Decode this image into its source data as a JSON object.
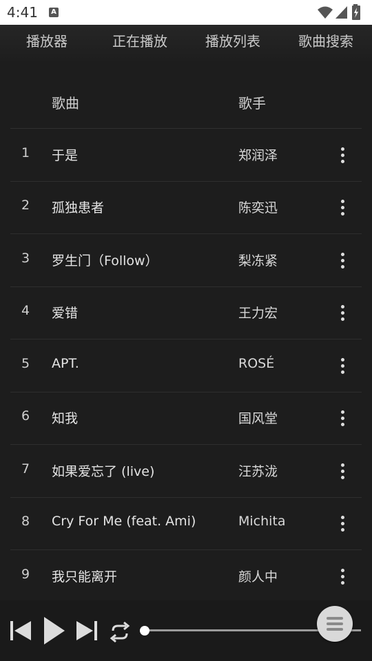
{
  "status_bar": {
    "time": "4:41",
    "notification_icon": "A",
    "icons": [
      "wifi-icon",
      "signal-icon",
      "battery-charging-icon"
    ]
  },
  "tabs": [
    {
      "label": "播放器"
    },
    {
      "label": "正在播放"
    },
    {
      "label": "播放列表"
    },
    {
      "label": "歌曲搜索"
    }
  ],
  "list_header": {
    "song": "歌曲",
    "artist": "歌手"
  },
  "songs": [
    {
      "num": "1",
      "title": "于是",
      "artist": "郑润泽"
    },
    {
      "num": "2",
      "title": "孤独患者",
      "artist": "陈奕迅"
    },
    {
      "num": "3",
      "title": "罗生门（Follow）",
      "artist": "梨冻紧"
    },
    {
      "num": "4",
      "title": "爱错",
      "artist": "王力宏"
    },
    {
      "num": "5",
      "title": "APT.",
      "artist": "ROSÉ"
    },
    {
      "num": "6",
      "title": "知我",
      "artist": "国风堂"
    },
    {
      "num": "7",
      "title": "如果爱忘了 (live)",
      "artist": "汪苏泷"
    },
    {
      "num": "8",
      "title": "Cry For Me (feat. Ami)",
      "artist": "Michita"
    },
    {
      "num": "9",
      "title": "我只能离开",
      "artist": "颜人中"
    }
  ],
  "player": {
    "controls": [
      "skip-previous-icon",
      "play-icon",
      "skip-next-icon",
      "repeat-icon"
    ],
    "progress": 0,
    "menu_icon": "menu-icon"
  },
  "colors": {
    "background": "#1d1d1d",
    "text": "#e4e4e4",
    "statusbar": "#ffffff"
  }
}
